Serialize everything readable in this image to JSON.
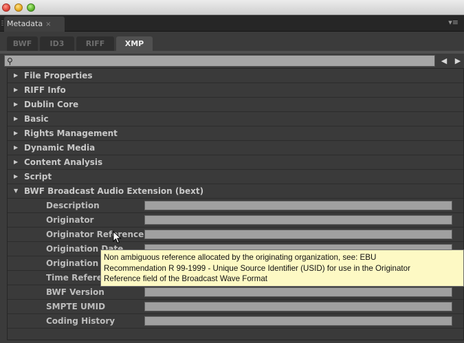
{
  "panel": {
    "tab_label": "Metadata",
    "close_glyph": "×",
    "menu_glyph": "▾≡"
  },
  "subtabs": [
    {
      "label": "BWF",
      "active": false
    },
    {
      "label": "ID3",
      "active": false
    },
    {
      "label": "RIFF",
      "active": false
    },
    {
      "label": "XMP",
      "active": true
    }
  ],
  "search": {
    "icon": "search-icon",
    "value": "",
    "placeholder": ""
  },
  "nav": {
    "prev_glyph": "◀",
    "next_glyph": "▶"
  },
  "sections": [
    {
      "label": "File Properties",
      "expanded": false
    },
    {
      "label": "RIFF Info",
      "expanded": false
    },
    {
      "label": "Dublin Core",
      "expanded": false
    },
    {
      "label": "Basic",
      "expanded": false
    },
    {
      "label": "Rights Management",
      "expanded": false
    },
    {
      "label": "Dynamic Media",
      "expanded": false
    },
    {
      "label": "Content Analysis",
      "expanded": false
    },
    {
      "label": "Script",
      "expanded": false
    },
    {
      "label": "BWF Broadcast Audio Extension (bext)",
      "expanded": true
    }
  ],
  "glyphs": {
    "collapsed": "▶",
    "expanded": "▼"
  },
  "bext_fields": [
    {
      "label": "Description",
      "value": ""
    },
    {
      "label": "Originator",
      "value": ""
    },
    {
      "label": "Originator Reference",
      "value": ""
    },
    {
      "label": "Origination Date",
      "value": ""
    },
    {
      "label": "Origination Time",
      "value": ""
    },
    {
      "label": "Time Reference",
      "value": ""
    },
    {
      "label": "BWF Version",
      "value": ""
    },
    {
      "label": "SMPTE UMID",
      "value": ""
    },
    {
      "label": "Coding History",
      "value": ""
    }
  ],
  "tooltip": {
    "line1": "Non ambiguous reference allocated by the originating organization, see: EBU",
    "line2": "Recommendation R 99-1999 - Unique Source Identifier (USID) for use in the Originator",
    "line3": "Reference field of the Broadcast Wave Format"
  },
  "colors": {
    "panel_bg": "#3b3b3b",
    "field_bg": "#a0a0a0",
    "tooltip_bg": "#fdf9c4",
    "traffic_close": "#e0443a",
    "traffic_min": "#e6a920",
    "traffic_max": "#5db52c"
  }
}
